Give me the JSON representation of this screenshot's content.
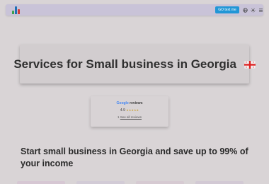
{
  "header": {
    "cta_label": "GO text me",
    "icons": [
      "globe-icon",
      "sun-icon",
      "menu-icon"
    ],
    "logo_colors": [
      "#3aa04a",
      "#1f6fb5",
      "#d13b35"
    ]
  },
  "hero": {
    "title": "Services for Small business in Georgia",
    "flag": "georgia-flag-icon"
  },
  "reviews": {
    "brand_google": "Google",
    "brand_reviews": "reviews",
    "rating": "4.9",
    "stars": "★★★★★",
    "prefix": "1",
    "link_text": "See all reviews"
  },
  "headline": "Start small business in Georgia and save up to 99% of your income",
  "colors": {
    "accent": "#2196d6",
    "header_bg": "#c9c3d8",
    "page_bg": "#d9d4d6"
  }
}
